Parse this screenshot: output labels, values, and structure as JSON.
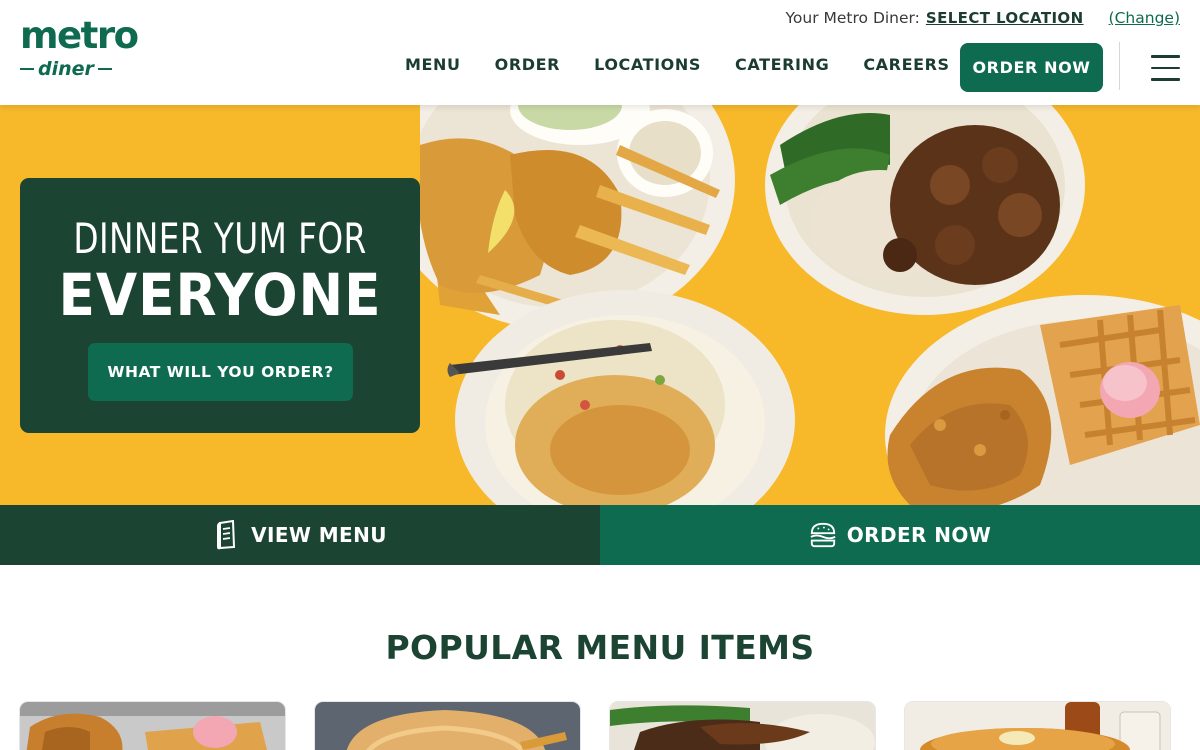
{
  "header": {
    "logo": {
      "top": "metro",
      "bottom": "diner"
    },
    "location": {
      "prefix": "Your Metro Diner:",
      "select_label": "SELECT LOCATION",
      "change_label": "(Change)"
    },
    "nav": [
      {
        "label": "MENU"
      },
      {
        "label": "ORDER"
      },
      {
        "label": "LOCATIONS"
      },
      {
        "label": "CATERING"
      },
      {
        "label": "CAREERS"
      }
    ],
    "order_now_label": "ORDER NOW",
    "menu_icon": "hamburger-icon"
  },
  "hero": {
    "line1": "DINNER YUM FOR",
    "line2": "EVERYONE",
    "cta_label": "WHAT WILL YOU ORDER?",
    "background_color": "#f7b82a",
    "card_color": "#1c4433"
  },
  "action_bar": {
    "view_menu_label": "VIEW MENU",
    "view_menu_icon": "menu-book-icon",
    "order_now_label": "ORDER NOW",
    "order_now_icon": "burger-icon"
  },
  "popular": {
    "title": "POPULAR MENU ITEMS",
    "cards": [
      {
        "image": "chicken-and-waffle-image"
      },
      {
        "image": "burger-and-fries-image"
      },
      {
        "image": "meatloaf-and-green-beans-image"
      },
      {
        "image": "pancakes-and-syrup-image"
      }
    ]
  },
  "colors": {
    "brand_green": "#0f6b4f",
    "dark_green": "#1c4433",
    "hero_yellow": "#f7b82a"
  }
}
